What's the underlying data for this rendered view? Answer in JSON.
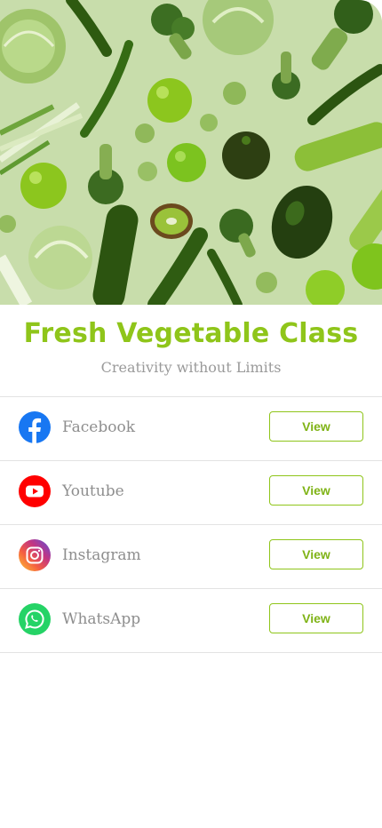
{
  "header": {
    "title": "Fresh Vegetable Class",
    "subtitle": "Creativity without Limits",
    "image": "green-vegetables-flatlay"
  },
  "links": [
    {
      "label": "Facebook",
      "icon": "facebook-icon",
      "button": "View",
      "color": "#1877F2"
    },
    {
      "label": "Youtube",
      "icon": "youtube-icon",
      "button": "View",
      "color": "#FF0000"
    },
    {
      "label": "Instagram",
      "icon": "instagram-icon",
      "button": "View",
      "color": "#C13584"
    },
    {
      "label": "WhatsApp",
      "icon": "whatsapp-icon",
      "button": "View",
      "color": "#25D366"
    }
  ],
  "colors": {
    "accent": "#8FC51A",
    "text_muted": "#8E8E8E",
    "divider": "#E3E3E3"
  }
}
